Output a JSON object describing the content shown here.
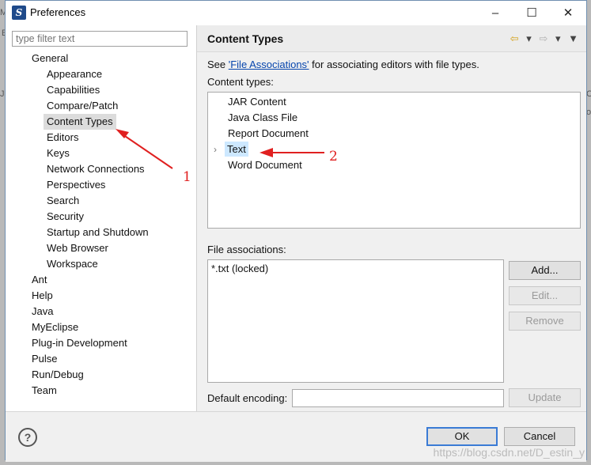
{
  "window": {
    "title": "Preferences",
    "app_icon": "myeclipse-logo",
    "minimize_glyph": "–",
    "maximize_glyph": "☐",
    "close_glyph": "✕"
  },
  "background": {
    "left_fragments": [
      "My",
      "E",
      "Ja"
    ],
    "right_fragments": [
      "C",
      "o"
    ]
  },
  "filter": {
    "placeholder": "type filter text"
  },
  "tree": {
    "general": "General",
    "general_children": [
      "Appearance",
      "Capabilities",
      "Compare/Patch",
      "Content Types",
      "Editors",
      "Keys",
      "Network Connections",
      "Perspectives",
      "Search",
      "Security",
      "Startup and Shutdown",
      "Web Browser",
      "Workspace"
    ],
    "top_level": [
      "Ant",
      "Help",
      "Java",
      "MyEclipse",
      "Plug-in Development",
      "Pulse",
      "Run/Debug",
      "Team"
    ],
    "selected": "Content Types"
  },
  "page": {
    "title": "Content Types",
    "see_prefix": "See ",
    "see_link": "'File Associations'",
    "see_suffix": " for associating editors with file types.",
    "content_types_label": "Content types:",
    "content_types": [
      "JAR Content",
      "Java Class File",
      "Report Document",
      "Text",
      "Word Document"
    ],
    "selected_content_type": "Text",
    "file_associations_label": "File associations:",
    "file_associations": [
      "*.txt (locked)"
    ],
    "default_encoding_label": "Default encoding:",
    "default_encoding_value": ""
  },
  "buttons": {
    "add": "Add...",
    "edit": "Edit...",
    "remove": "Remove",
    "update": "Update",
    "ok": "OK",
    "cancel": "Cancel"
  },
  "icons": {
    "back": "back-arrow-icon",
    "forward": "forward-arrow-icon",
    "menu": "view-menu-icon",
    "help": "help-icon"
  },
  "annotations": {
    "marker_1": "1",
    "marker_2": "2",
    "color": "#e02020"
  },
  "watermark": "https://blog.csdn.net/D_estin_y"
}
